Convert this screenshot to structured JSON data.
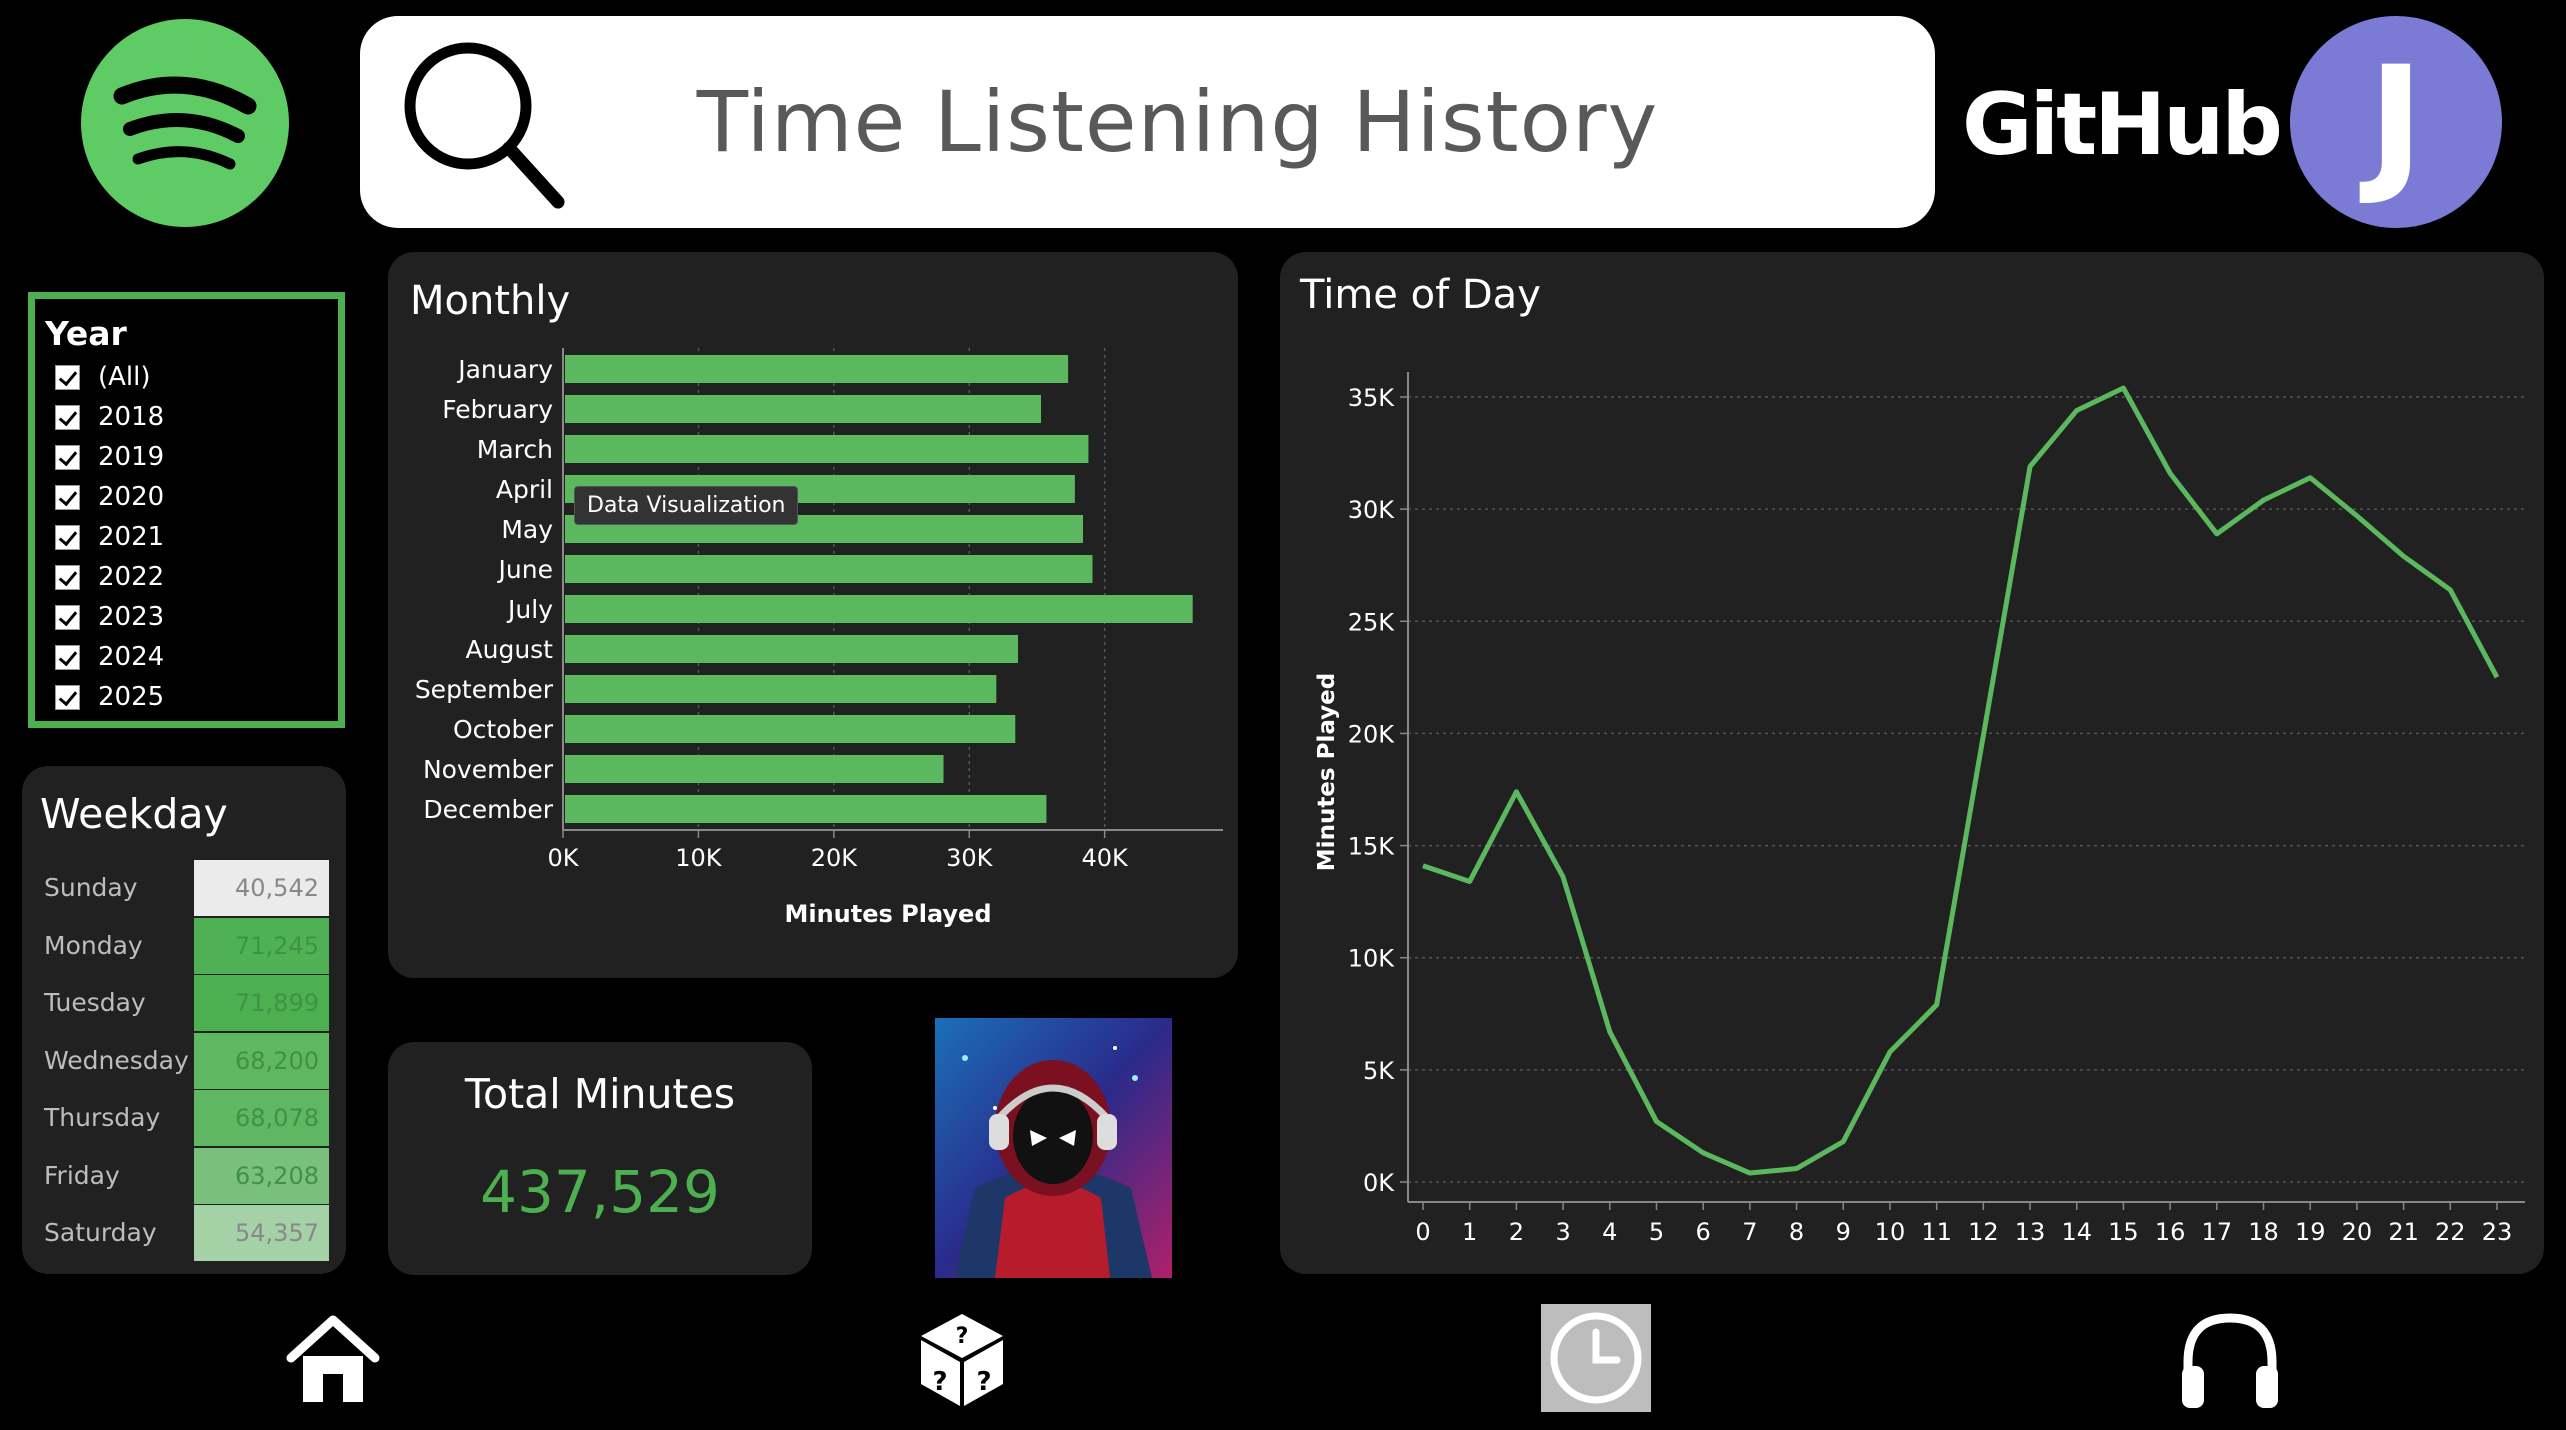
{
  "header": {
    "title": "Time Listening History",
    "github_label": "GitHub",
    "avatar_initial": "J"
  },
  "year_filter": {
    "title": "Year",
    "items": [
      "(All)",
      "2018",
      "2019",
      "2020",
      "2021",
      "2022",
      "2023",
      "2024",
      "2025"
    ]
  },
  "weekday": {
    "title": "Weekday",
    "rows": [
      {
        "day": "Sunday",
        "minutes": "40,542",
        "value": 40542
      },
      {
        "day": "Monday",
        "minutes": "71,245",
        "value": 71245
      },
      {
        "day": "Tuesday",
        "minutes": "71,899",
        "value": 71899
      },
      {
        "day": "Wednesday",
        "minutes": "68,200",
        "value": 68200
      },
      {
        "day": "Thursday",
        "minutes": "68,078",
        "value": 68078
      },
      {
        "day": "Friday",
        "minutes": "63,208",
        "value": 63208
      },
      {
        "day": "Saturday",
        "minutes": "54,357",
        "value": 54357
      }
    ]
  },
  "total": {
    "title": "Total Minutes",
    "value": "437,529"
  },
  "tooltip": "Data Visualization",
  "colors": {
    "accent": "#4cb050",
    "panel": "#212121",
    "avatar": "#7b7bd6"
  },
  "nav_icons": [
    "home-icon",
    "dice-icon",
    "clock-icon",
    "headphones-icon"
  ],
  "chart_data": [
    {
      "type": "bar",
      "orientation": "horizontal",
      "title": "Monthly",
      "xlabel": "Minutes Played",
      "categories": [
        "January",
        "February",
        "March",
        "April",
        "May",
        "June",
        "July",
        "August",
        "September",
        "October",
        "November",
        "December"
      ],
      "values": [
        37300,
        35300,
        38800,
        37800,
        38400,
        39100,
        46500,
        33600,
        32000,
        33400,
        28100,
        35700
      ],
      "xlim": [
        0,
        48000
      ],
      "xticks": [
        0,
        10000,
        20000,
        30000,
        40000
      ],
      "xtick_labels": [
        "0K",
        "10K",
        "20K",
        "30K",
        "40K"
      ],
      "grid": true
    },
    {
      "type": "line",
      "title": "Time of Day",
      "ylabel": "Minutes Played",
      "x": [
        0,
        1,
        2,
        3,
        4,
        5,
        6,
        7,
        8,
        9,
        10,
        11,
        12,
        13,
        14,
        15,
        16,
        17,
        18,
        19,
        20,
        21,
        22,
        23
      ],
      "values": [
        14100,
        13400,
        17400,
        13600,
        6700,
        2700,
        1300,
        400,
        600,
        1800,
        5800,
        7900,
        19900,
        31900,
        34400,
        35400,
        31600,
        28900,
        30400,
        31400,
        29700,
        27900,
        26400,
        22500
      ],
      "ylim": [
        0,
        36000
      ],
      "yticks": [
        0,
        5000,
        10000,
        15000,
        20000,
        25000,
        30000,
        35000
      ],
      "ytick_labels": [
        "0K",
        "5K",
        "10K",
        "15K",
        "20K",
        "25K",
        "30K",
        "35K"
      ],
      "grid": true
    }
  ]
}
